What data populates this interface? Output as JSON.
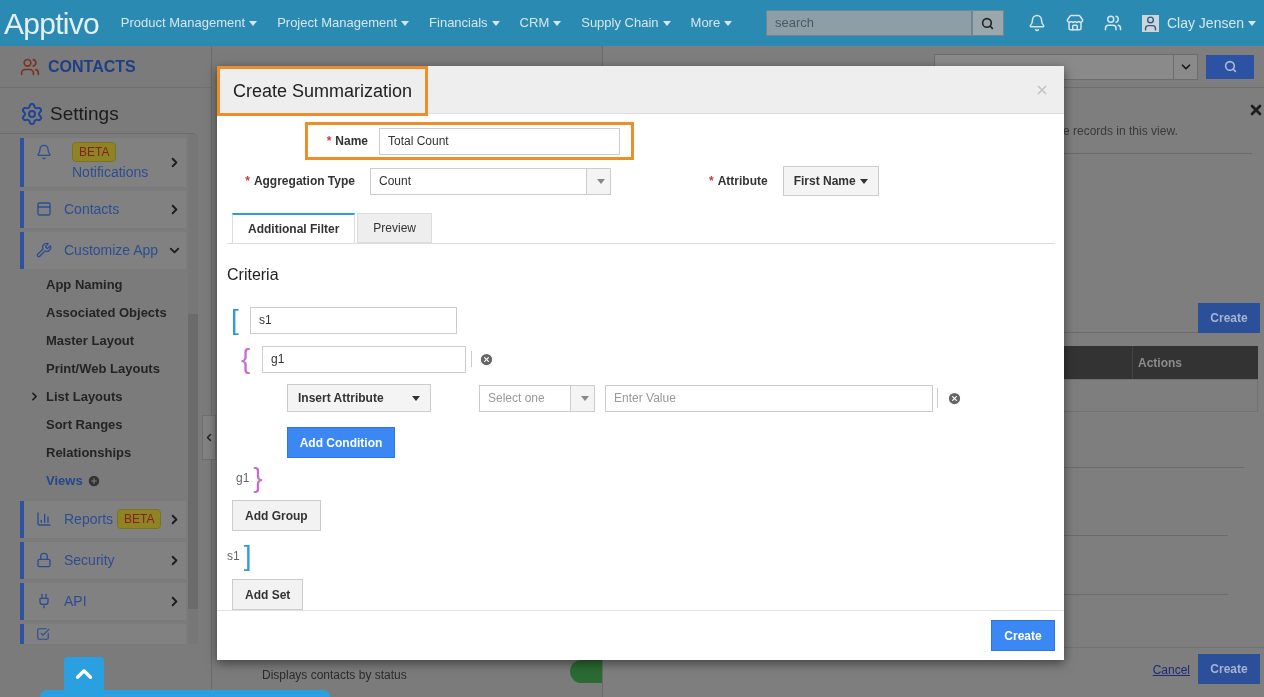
{
  "nav": {
    "logo": "Apptivo",
    "menus": [
      {
        "label": "Product Management"
      },
      {
        "label": "Project Management"
      },
      {
        "label": "Financials"
      },
      {
        "label": "CRM"
      },
      {
        "label": "Supply Chain"
      },
      {
        "label": "More"
      }
    ],
    "search": {
      "placeholder": "search"
    },
    "user": "Clay Jensen"
  },
  "app_header": {
    "title": "CONTACTS"
  },
  "sidebar": {
    "title": "Settings",
    "items": [
      {
        "label": "Notifications",
        "badge": "BETA",
        "expanded": false
      },
      {
        "label": "Contacts",
        "expanded": false
      },
      {
        "label": "Customize App",
        "expanded": true,
        "children": [
          {
            "label": "App Naming",
            "kind": "item",
            "selected": false
          },
          {
            "label": "Associated Objects",
            "kind": "item",
            "selected": false
          },
          {
            "label": "Master Layout",
            "kind": "item",
            "selected": false
          },
          {
            "label": "Print/Web Layouts",
            "kind": "item",
            "selected": false
          },
          {
            "label": "List Layouts",
            "kind": "item",
            "selected": true
          },
          {
            "label": "Sort Ranges",
            "kind": "item",
            "selected": false
          },
          {
            "label": "Relationships",
            "kind": "item",
            "selected": false
          },
          {
            "label": "Views",
            "kind": "add",
            "selected": false
          }
        ]
      },
      {
        "label": "Reports",
        "badge": "BETA",
        "expanded": false
      },
      {
        "label": "Security",
        "expanded": false
      },
      {
        "label": "API",
        "expanded": false
      }
    ]
  },
  "background_view": {
    "hint": "e records in this view.",
    "create_button": "Create",
    "table": {
      "columns": [
        "Actions"
      ]
    },
    "list_item": {
      "description": "Displays contacts by status",
      "on": true
    },
    "cancel_link": "Cancel",
    "footer_create_button": "Create"
  },
  "modal": {
    "title": "Create Summarization",
    "title_highlighted": true,
    "name": {
      "label": "Name",
      "required_mark": "*",
      "value": "Total Count",
      "highlighted": true
    },
    "aggregation_type": {
      "label": "Aggregation Type",
      "required_mark": "*",
      "value": "Count"
    },
    "attribute": {
      "label": "Attribute",
      "required_mark": "*",
      "value": "First Name"
    },
    "tabs": [
      {
        "label": "Additional Filter",
        "selected": true
      },
      {
        "label": "Preview",
        "selected": false
      }
    ],
    "criteria": {
      "heading": "Criteria",
      "sets": [
        {
          "open_bracket": "[",
          "value": "s1",
          "close_label": "s1",
          "close_bracket": "]",
          "groups": [
            {
              "open_bracket": "{",
              "value": "g1",
              "close_label": "g1",
              "close_bracket": "}",
              "conditions": [
                {
                  "attribute": "Insert Attribute",
                  "operator_placeholder": "Select one",
                  "value_placeholder": "Enter Value"
                }
              ]
            }
          ]
        }
      ]
    },
    "add_condition": "Add Condition",
    "add_group": "Add Group",
    "add_set": "Add Set",
    "create_button": "Create"
  }
}
